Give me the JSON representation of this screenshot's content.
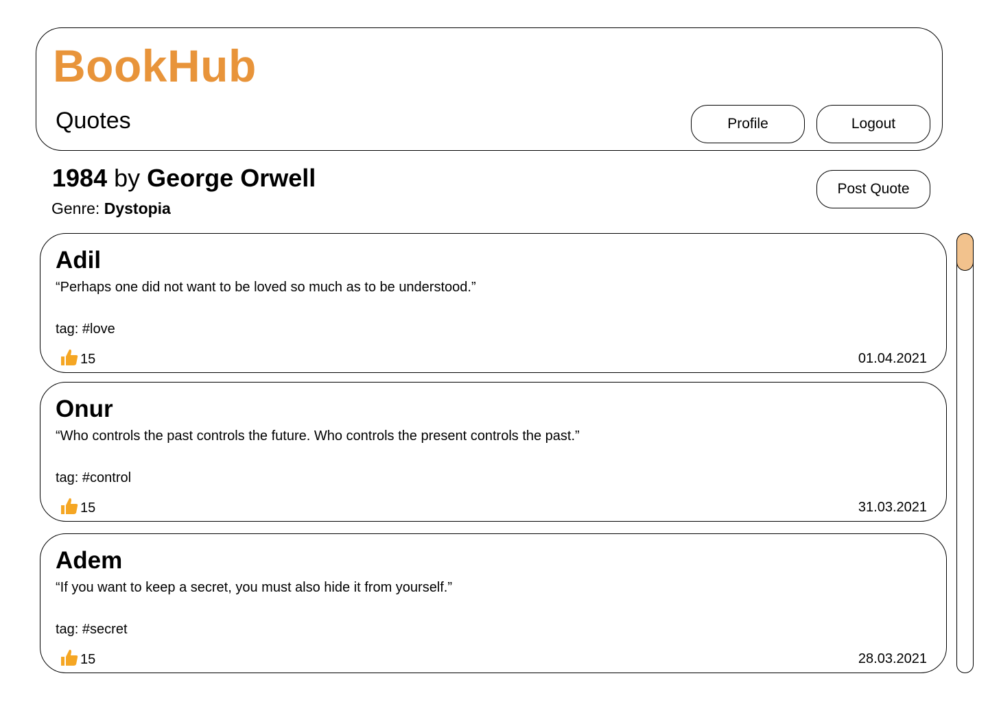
{
  "header": {
    "brand": "BookHub",
    "section_title": "Quotes",
    "profile_label": "Profile",
    "logout_label": "Logout"
  },
  "book": {
    "title": "1984",
    "by": "by",
    "author": "George Orwell",
    "genre_label": "Genre:",
    "genre": "Dystopia",
    "post_quote_label": "Post Quote"
  },
  "colors": {
    "brand": "#E8943A",
    "thumb_icon": "#F5A623",
    "scroll_thumb": "#F2C28D"
  },
  "quotes": [
    {
      "author": "Adil",
      "text": "“Perhaps one did not want to be loved so much as to be understood.”",
      "tag": "tag: #love",
      "likes": "15",
      "date": "01.04.2021",
      "icon": "thumbs-up-icon"
    },
    {
      "author": "Onur",
      "text": "“Who controls the past controls the future. Who controls the present controls the past.”",
      "tag": "tag: #control",
      "likes": "15",
      "date": "31.03.2021",
      "icon": "thumbs-up-icon"
    },
    {
      "author": "Adem",
      "text": "“If you want to keep a secret, you must also hide it from yourself.”",
      "tag": "tag: #secret",
      "likes": "15",
      "date": "28.03.2021",
      "icon": "thumbs-up-icon"
    }
  ]
}
